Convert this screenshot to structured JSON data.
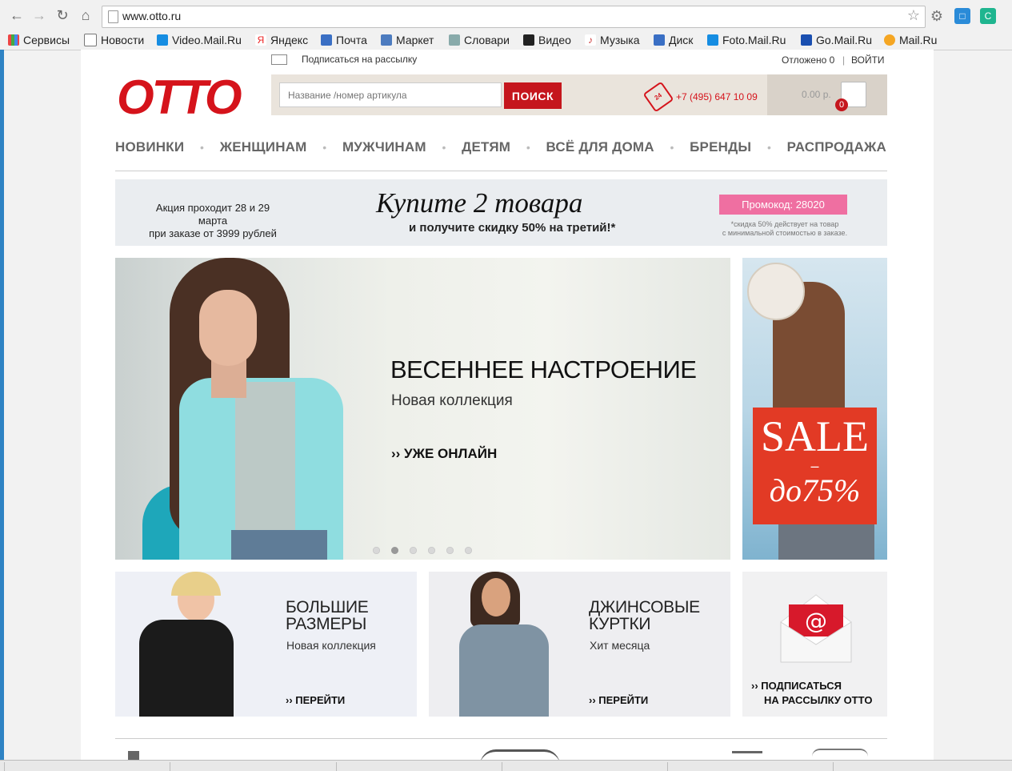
{
  "browser": {
    "url": "www.otto.ru",
    "bookmarks": [
      "Сервисы",
      "Новости",
      "Video.Mail.Ru",
      "Яндекс",
      "Почта",
      "Маркет",
      "Словари",
      "Видео",
      "Музыка",
      "Диск",
      "Foto.Mail.Ru",
      "Go.Mail.Ru",
      "Mail.Ru"
    ],
    "extension_label": "C"
  },
  "header": {
    "newsletter_link": "Подписаться на рассылку",
    "saved": "Отложено 0",
    "separator": "|",
    "login": "ВОЙТИ",
    "logo": "OTTO",
    "search_placeholder": "Название /номер артикула",
    "search_button": "ПОИСК",
    "phone": "+7 (495) 647 10 09",
    "phone_icon_text": "24",
    "cart_total": "0.00 р.",
    "cart_count": "0"
  },
  "nav": [
    "НОВИНКИ",
    "ЖЕНЩИНАМ",
    "МУЖЧИНАМ",
    "ДЕТЯМ",
    "ВСЁ ДЛЯ ДОМА",
    "БРЕНДЫ",
    "РАСПРОДАЖА"
  ],
  "promo": {
    "left_line1": "Акция проходит 28 и 29 марта",
    "left_line2": "при заказе от 3999 рублей",
    "headline": "Купите 2 товара",
    "subline": "и получите скидку 50% на третий!*",
    "code": "Промокод: 28020",
    "note_line1": "*скидка 50% действует на товар",
    "note_line2": "с минимальной стоимостью в заказе."
  },
  "hero": {
    "title": "ВЕСЕННЕЕ НАСТРОЕНИЕ",
    "subtitle": "Новая коллекция",
    "cta": "›› УЖЕ ОНЛАЙН",
    "slide_count": 6,
    "active_slide": 2
  },
  "sale": {
    "word": "SALE",
    "dash": "–",
    "percent": "до75%"
  },
  "tiles": [
    {
      "title_line1": "БОЛЬШИЕ",
      "title_line2": "РАЗМЕРЫ",
      "subtitle": "Новая коллекция",
      "cta": "›› ПЕРЕЙТИ"
    },
    {
      "title_line1": "ДЖИНСОВЫЕ",
      "title_line2": "КУРТКИ",
      "subtitle": "Хит месяца",
      "cta": "›› ПЕРЕЙТИ"
    }
  ],
  "subscribe": {
    "line1": "›› ПОДПИСАТЬСЯ",
    "line2": "НА РАССЫЛКУ OTTO"
  },
  "colors": {
    "brand_red": "#d5131b",
    "promo_pink": "#ef6fa1",
    "sale_red": "#e23a25"
  }
}
